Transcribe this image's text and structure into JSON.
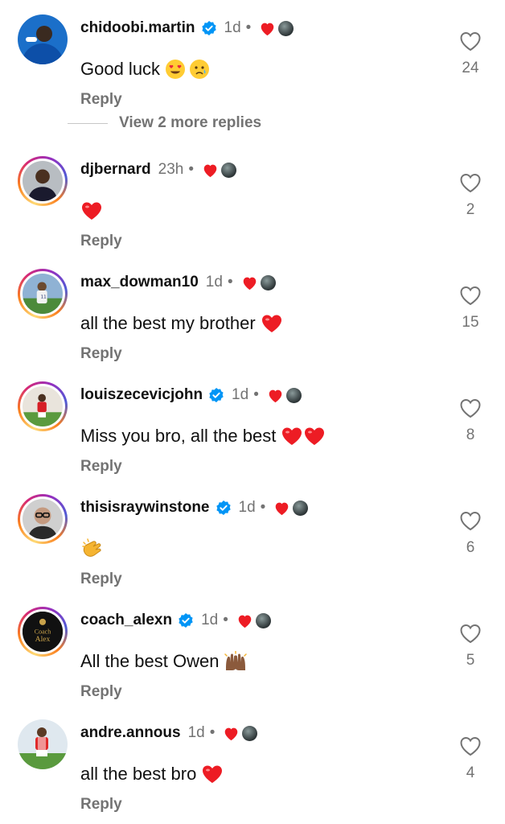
{
  "comments": [
    {
      "username": "chidoobi.martin",
      "verified": true,
      "time": "1d",
      "text": "Good luck",
      "emoji": [
        "heart-eyes",
        "crying-face"
      ],
      "reply_label": "Reply",
      "likes": "24",
      "avatar": "player-blue-kit",
      "story_ring": false
    },
    {
      "username": "djbernard",
      "verified": false,
      "time": "23h",
      "text": "",
      "emoji": [
        "red-heart"
      ],
      "reply_label": "Reply",
      "likes": "2",
      "avatar": "player-dark-kit",
      "story_ring": true
    },
    {
      "username": "max_dowman10",
      "verified": false,
      "time": "1d",
      "text": "all the best my brother",
      "emoji": [
        "red-heart"
      ],
      "reply_label": "Reply",
      "likes": "15",
      "avatar": "player-white-kit",
      "story_ring": true
    },
    {
      "username": "louiszecevicjohn",
      "verified": true,
      "time": "1d",
      "text": "Miss you bro, all the best",
      "emoji": [
        "red-heart",
        "red-heart"
      ],
      "reply_label": "Reply",
      "likes": "8",
      "avatar": "player-red-kit",
      "story_ring": true
    },
    {
      "username": "thisisraywinstone",
      "verified": true,
      "time": "1d",
      "text": "",
      "emoji": [
        "clapping-hands"
      ],
      "reply_label": "Reply",
      "likes": "6",
      "avatar": "man-glasses",
      "story_ring": true
    },
    {
      "username": "coach_alexn",
      "verified": true,
      "time": "1d",
      "text": "All the best Owen",
      "emoji": [
        "raising-hands"
      ],
      "reply_label": "Reply",
      "likes": "5",
      "avatar": "coach-alex-logo",
      "avatar_text_1": "Coach",
      "avatar_text_2": "Alex",
      "story_ring": true
    },
    {
      "username": "andre.annous",
      "verified": false,
      "time": "1d",
      "text": "all the best bro",
      "emoji": [
        "red-heart"
      ],
      "reply_label": "Reply",
      "likes": "4",
      "avatar": "player-red-white-kit",
      "story_ring": false
    }
  ],
  "view_more_replies": "View 2 more replies",
  "separator": "•",
  "colors": {
    "meta_gray": "#737373",
    "verified_blue": "#0095f6",
    "heart_red": "#ed1c24"
  },
  "icons": {
    "like": "heart-outline-icon",
    "verified": "verified-badge-icon",
    "creator_like": "red-heart-icon"
  }
}
